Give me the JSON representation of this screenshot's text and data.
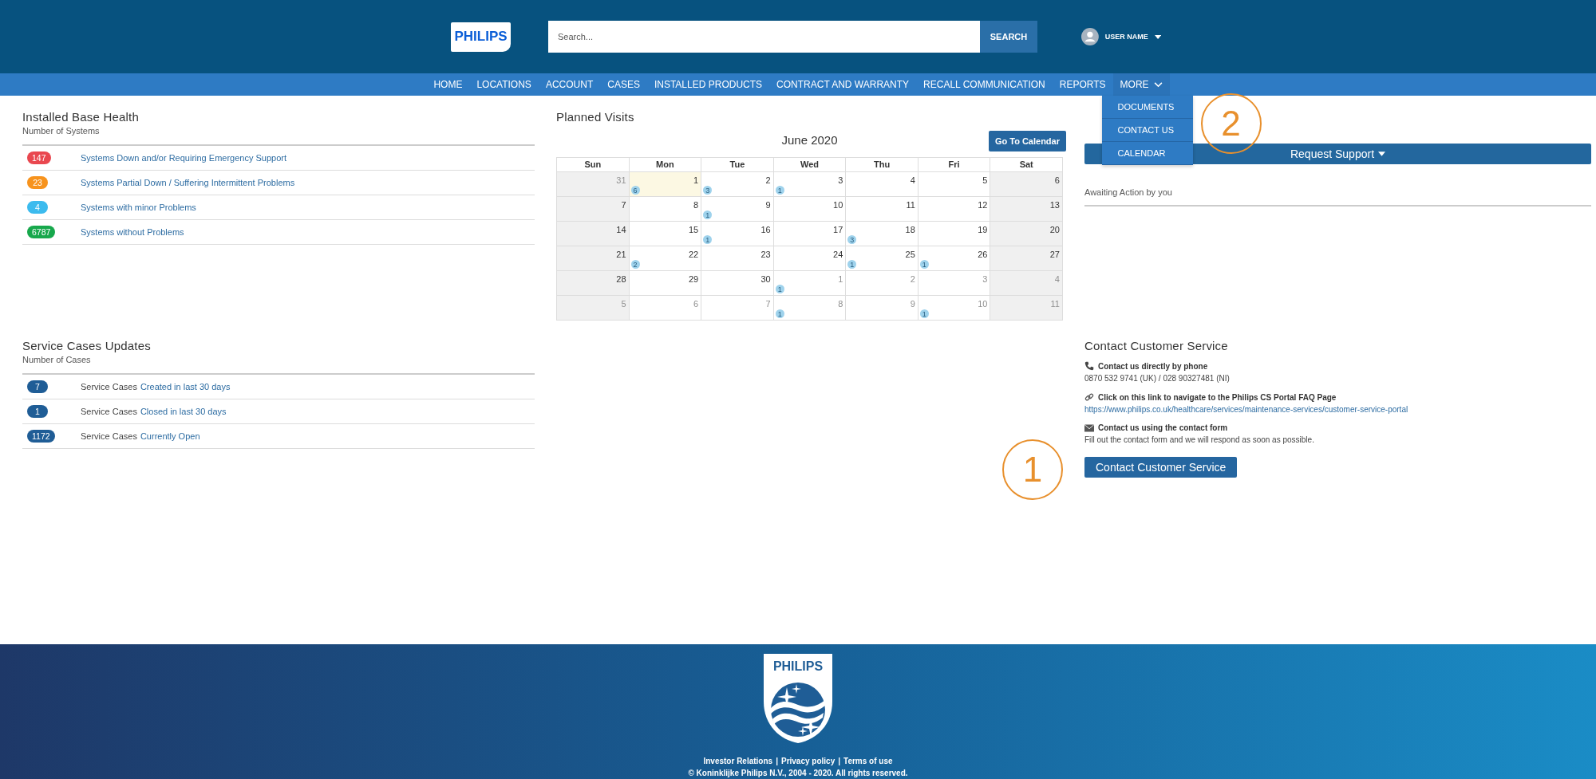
{
  "header": {
    "logo": "PHILIPS",
    "search": {
      "placeholder": "Search...",
      "button": "SEARCH"
    },
    "user": {
      "name": "USER NAME"
    }
  },
  "nav": {
    "items": [
      "HOME",
      "LOCATIONS",
      "ACCOUNT",
      "CASES",
      "INSTALLED PRODUCTS",
      "CONTRACT AND WARRANTY",
      "RECALL COMMUNICATION",
      "REPORTS"
    ],
    "more": {
      "label": "MORE",
      "expanded": true,
      "callout": "2",
      "items": [
        "DOCUMENTS",
        "CONTACT US",
        "CALENDAR"
      ]
    }
  },
  "installed_base": {
    "title": "Installed Base Health",
    "subtitle": "Number of Systems",
    "rows": [
      {
        "count": "147",
        "color": "#e9474f",
        "label": "Systems Down and/or Requiring Emergency Support"
      },
      {
        "count": "23",
        "color": "#f7931d",
        "label": "Systems Partial Down / Suffering Intermittent Problems"
      },
      {
        "count": "4",
        "color": "#3cbbee",
        "label": "Systems with minor Problems"
      },
      {
        "count": "6787",
        "color": "#17a84c",
        "label": "Systems without Problems"
      }
    ]
  },
  "service_cases": {
    "title": "Service Cases Updates",
    "subtitle": "Number of Cases",
    "rows": [
      {
        "count": "7",
        "label": "Service Cases",
        "link": "Created in last 30 days"
      },
      {
        "count": "1",
        "label": "Service Cases",
        "link": "Closed in last 30 days"
      },
      {
        "count": "1172",
        "label": "Service Cases",
        "link": "Currently Open"
      }
    ]
  },
  "planned_visits": {
    "title": "Planned Visits",
    "month": "June 2020",
    "button": "Go To Calendar",
    "weekdays": [
      "Sun",
      "Mon",
      "Tue",
      "Wed",
      "Thu",
      "Fri",
      "Sat"
    ],
    "weeks": [
      [
        {
          "day": "31",
          "outside": true,
          "today": false
        },
        {
          "day": "1",
          "outside": false,
          "today": true,
          "count": "6"
        },
        {
          "day": "2",
          "outside": false,
          "today": false,
          "count": "3"
        },
        {
          "day": "3",
          "outside": false,
          "today": false,
          "count": "1"
        },
        {
          "day": "4",
          "outside": false,
          "today": false
        },
        {
          "day": "5",
          "outside": false,
          "today": false
        },
        {
          "day": "6",
          "outside": false,
          "today": false
        }
      ],
      [
        {
          "day": "7",
          "outside": false,
          "today": false
        },
        {
          "day": "8",
          "outside": false,
          "today": false
        },
        {
          "day": "9",
          "outside": false,
          "today": false,
          "count": "1"
        },
        {
          "day": "10",
          "outside": false,
          "today": false
        },
        {
          "day": "11",
          "outside": false,
          "today": false
        },
        {
          "day": "12",
          "outside": false,
          "today": false
        },
        {
          "day": "13",
          "outside": false,
          "today": false
        }
      ],
      [
        {
          "day": "14",
          "outside": false,
          "today": false
        },
        {
          "day": "15",
          "outside": false,
          "today": false
        },
        {
          "day": "16",
          "outside": false,
          "today": false,
          "count": "1"
        },
        {
          "day": "17",
          "outside": false,
          "today": false
        },
        {
          "day": "18",
          "outside": false,
          "today": false,
          "count": "3"
        },
        {
          "day": "19",
          "outside": false,
          "today": false
        },
        {
          "day": "20",
          "outside": false,
          "today": false
        }
      ],
      [
        {
          "day": "21",
          "outside": false,
          "today": false
        },
        {
          "day": "22",
          "outside": false,
          "today": false,
          "count": "2"
        },
        {
          "day": "23",
          "outside": false,
          "today": false
        },
        {
          "day": "24",
          "outside": false,
          "today": false
        },
        {
          "day": "25",
          "outside": false,
          "today": false,
          "count": "1"
        },
        {
          "day": "26",
          "outside": false,
          "today": false,
          "count": "1"
        },
        {
          "day": "27",
          "outside": false,
          "today": false
        }
      ],
      [
        {
          "day": "28",
          "outside": false,
          "today": false
        },
        {
          "day": "29",
          "outside": false,
          "today": false
        },
        {
          "day": "30",
          "outside": false,
          "today": false
        },
        {
          "day": "1",
          "outside": true,
          "today": false,
          "count": "1"
        },
        {
          "day": "2",
          "outside": true,
          "today": false
        },
        {
          "day": "3",
          "outside": true,
          "today": false
        },
        {
          "day": "4",
          "outside": true,
          "today": false
        }
      ],
      [
        {
          "day": "5",
          "outside": true,
          "today": false
        },
        {
          "day": "6",
          "outside": true,
          "today": false
        },
        {
          "day": "7",
          "outside": true,
          "today": false
        },
        {
          "day": "8",
          "outside": true,
          "today": false,
          "count": "1"
        },
        {
          "day": "9",
          "outside": true,
          "today": false
        },
        {
          "day": "10",
          "outside": true,
          "today": false,
          "count": "1"
        },
        {
          "day": "11",
          "outside": true,
          "today": false
        }
      ]
    ]
  },
  "request_support": {
    "button": "Request Support",
    "awaiting": "Awaiting Action by you"
  },
  "contact": {
    "title": "Contact Customer Service",
    "items": [
      {
        "kind": "phone",
        "label": "Contact us directly by phone",
        "text": "0870 532 9741 (UK) / 028 90327481 (NI)"
      },
      {
        "kind": "link",
        "label": "Click on this link to navigate to the Philips CS Portal FAQ Page",
        "url": "https://www.philips.co.uk/healthcare/services/maintenance-services/customer-service-portal"
      },
      {
        "kind": "mail",
        "label": "Contact us using the contact form",
        "text": "Fill out the contact form and we will respond as soon as possible."
      }
    ],
    "button": "Contact Customer Service",
    "callout": "1"
  },
  "footer": {
    "logo": "PHILIPS",
    "links": [
      "Investor Relations",
      "Privacy policy",
      "Terms of use"
    ],
    "separator": "|",
    "copyright": "© Koninklijke Philips N.V., 2004 - 2020. All rights reserved."
  }
}
